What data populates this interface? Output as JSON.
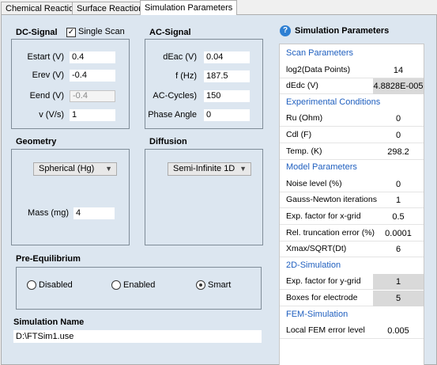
{
  "tabs": [
    {
      "label": "Chemical Reactions"
    },
    {
      "label": "Surface Reactions"
    },
    {
      "label": "Simulation Parameters"
    }
  ],
  "dc_signal": {
    "title": "DC-Signal",
    "single_scan_label": "Single Scan",
    "single_scan_checked": true,
    "fields": [
      {
        "label": "Estart (V)",
        "value": "0.4"
      },
      {
        "label": "Erev (V)",
        "value": "-0.4"
      },
      {
        "label": "Eend (V)",
        "value": "-0.4",
        "disabled": true
      },
      {
        "label": "v (V/s)",
        "value": "1"
      }
    ]
  },
  "ac_signal": {
    "title": "AC-Signal",
    "fields": [
      {
        "label": "dEac (V)",
        "value": "0.04"
      },
      {
        "label": "f (Hz)",
        "value": "187.5"
      },
      {
        "label": "AC-Cycles)",
        "value": "150"
      },
      {
        "label": "Phase Angle",
        "value": "0"
      }
    ]
  },
  "geometry": {
    "title": "Geometry",
    "selected": "Spherical (Hg)",
    "mass_label": "Mass (mg)",
    "mass_value": "4"
  },
  "diffusion": {
    "title": "Diffusion",
    "selected": "Semi-Infinite 1D"
  },
  "pre_equilibrium": {
    "title": "Pre-Equilibrium",
    "options": [
      "Disabled",
      "Enabled",
      "Smart"
    ],
    "selected": "Smart"
  },
  "simulation_name": {
    "title": "Simulation Name",
    "value": "D:\\FTSim1.use"
  },
  "sim_params": {
    "title": "Simulation Parameters",
    "icon": "help-icon",
    "rows": [
      {
        "type": "header",
        "name": "Scan Parameters"
      },
      {
        "type": "param",
        "name": "log2(Data Points)",
        "value": "14"
      },
      {
        "type": "param",
        "name": "dEdc (V)",
        "value": "4.8828E-005",
        "grey": true
      },
      {
        "type": "header",
        "name": "Experimental Conditions"
      },
      {
        "type": "param",
        "name": "Ru (Ohm)",
        "value": "0"
      },
      {
        "type": "param",
        "name": "Cdl (F)",
        "value": "0"
      },
      {
        "type": "param",
        "name": "Temp. (K)",
        "value": "298.2"
      },
      {
        "type": "header",
        "name": "Model Parameters"
      },
      {
        "type": "param",
        "name": "Noise level (%)",
        "value": "0"
      },
      {
        "type": "param",
        "name": "Gauss-Newton iterations",
        "value": "1"
      },
      {
        "type": "param",
        "name": "Exp. factor for x-grid",
        "value": "0.5"
      },
      {
        "type": "param",
        "name": "Rel. truncation error (%)",
        "value": "0.0001"
      },
      {
        "type": "param",
        "name": "Xmax/SQRT(Dt)",
        "value": "6"
      },
      {
        "type": "header",
        "name": "2D-Simulation"
      },
      {
        "type": "param",
        "name": "Exp. factor for y-grid",
        "value": "1",
        "grey": true
      },
      {
        "type": "param",
        "name": "Boxes for electrode",
        "value": "5",
        "grey": true
      },
      {
        "type": "header",
        "name": "FEM-Simulation"
      },
      {
        "type": "param",
        "name": "Local FEM error level",
        "value": "0.005"
      }
    ]
  }
}
